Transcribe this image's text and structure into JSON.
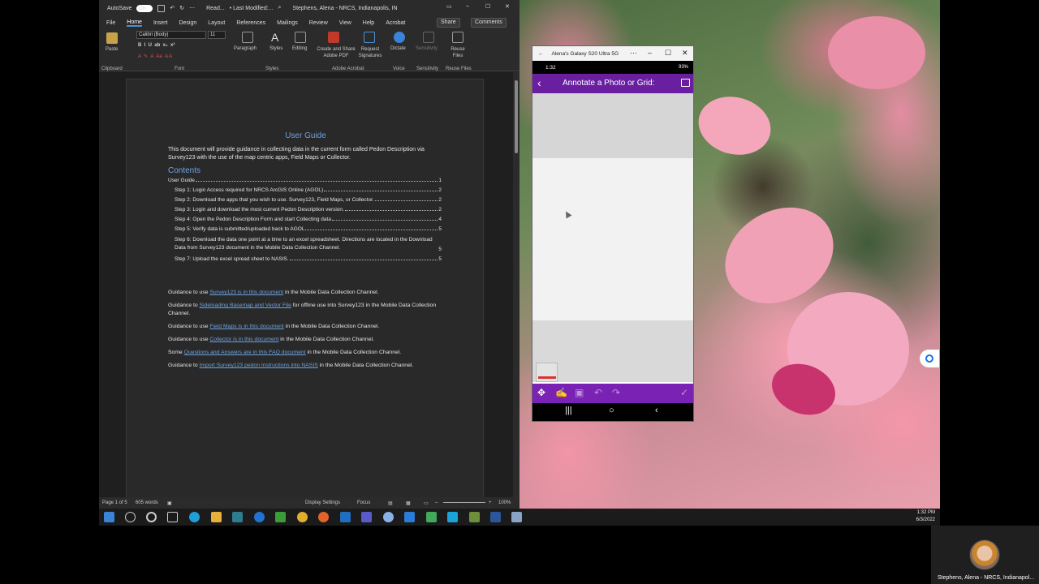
{
  "word": {
    "titlebar": {
      "autosave_label": "AutoSave",
      "autosave_state": "On",
      "filename": "Read...",
      "last_modified": "•  Last Modified:...",
      "account": "Stephens, Alena - NRCS, Indianapolis, IN"
    },
    "tabs": [
      "File",
      "Home",
      "Insert",
      "Design",
      "Layout",
      "References",
      "Mailings",
      "Review",
      "View",
      "Help",
      "Acrobat"
    ],
    "share_label": "Share",
    "comments_label": "Comments",
    "ribbon": {
      "paste": "Paste",
      "font_name": "Calibri (Body)",
      "font_size": "11",
      "paragraph": "Paragraph",
      "styles": "Styles",
      "editing": "Editing",
      "create_share_pdf": "Create and Share Adobe PDF",
      "request_signatures": "Request Signatures",
      "dictate": "Dictate",
      "sensitivity": "Sensitivity",
      "reuse_files": "Reuse Files",
      "groups": [
        "Clipboard",
        "Font",
        "Styles",
        "Adobe Acrobat",
        "Voice",
        "Sensitivity",
        "Reuse Files"
      ]
    },
    "document": {
      "title": "User Guide",
      "intro": "This document will provide guidance in collecting data in the current form called Pedon Description via Survey123 with the use of the map centric apps, Field Maps or Collector.",
      "contents_heading": "Contents",
      "toc": [
        {
          "text": "User Guide",
          "page": "1"
        },
        {
          "text": "Step 1: Login Access required for NRCS ArcGIS Online (AGOL)",
          "page": "2"
        },
        {
          "text": "Step 2: Download the apps that you wish to use. Survey123, Field Maps, or Collector.",
          "page": "2"
        },
        {
          "text": "Step 3: Login and download the most current Pedon Description version.",
          "page": "2"
        },
        {
          "text": "Step 4: Open the Pedon Description Form and start Collecting data",
          "page": "4"
        },
        {
          "text": "Step 5: Verify data is submitted/uploaded back to AGOL",
          "page": "5"
        },
        {
          "text": "Step 6: Download the data one point at a time to an excel spreadsheet. Directions are located in the Download Data from Survey123 document in the Mobile Data Collection Channel.",
          "page": "5"
        },
        {
          "text": "Step 7: Upload the excel spread sheet to NASIS.",
          "page": "5"
        }
      ],
      "guides": [
        {
          "pre": "Guidance to use ",
          "link": "Survey123 is in this document",
          "post": " in the Mobile Data Collection Channel."
        },
        {
          "pre": "Guidance to ",
          "link": "Sideloading Basemap and Vector File",
          "post": " for offline use into Survey123 in the Mobile Data Collection Channel."
        },
        {
          "pre": "Guidance to use ",
          "link": "Field Maps is in this document",
          "post": " in the Mobile Data Collection Channel."
        },
        {
          "pre": "Guidance to use ",
          "link": "Collector is in this document",
          "post": " in the Mobile Data Collection Channel."
        },
        {
          "pre": "Some ",
          "link": "Questions and Answers are in this FAQ document",
          "post": " in the Mobile Data Collection Channel."
        },
        {
          "pre": "Guidance to ",
          "link": "Import Survey123 pedon Instructions into NASIS",
          "post": " in the Mobile Data Collection Channel."
        }
      ]
    },
    "status": {
      "page": "Page 1 of 5",
      "words": "605 words",
      "display_settings": "Display Settings",
      "focus": "Focus",
      "zoom": "100%"
    }
  },
  "phone": {
    "window_title": "Alena's Galaxy S20 Ultra 5G",
    "time": "1:32",
    "battery": "93%",
    "app_title": "Annotate a Photo or Grid:"
  },
  "taskbar": {
    "time": "1:32 PM",
    "date": "6/3/2022"
  },
  "participant": {
    "name": "Stephens, Alena - NRCS, Indianapol..."
  }
}
